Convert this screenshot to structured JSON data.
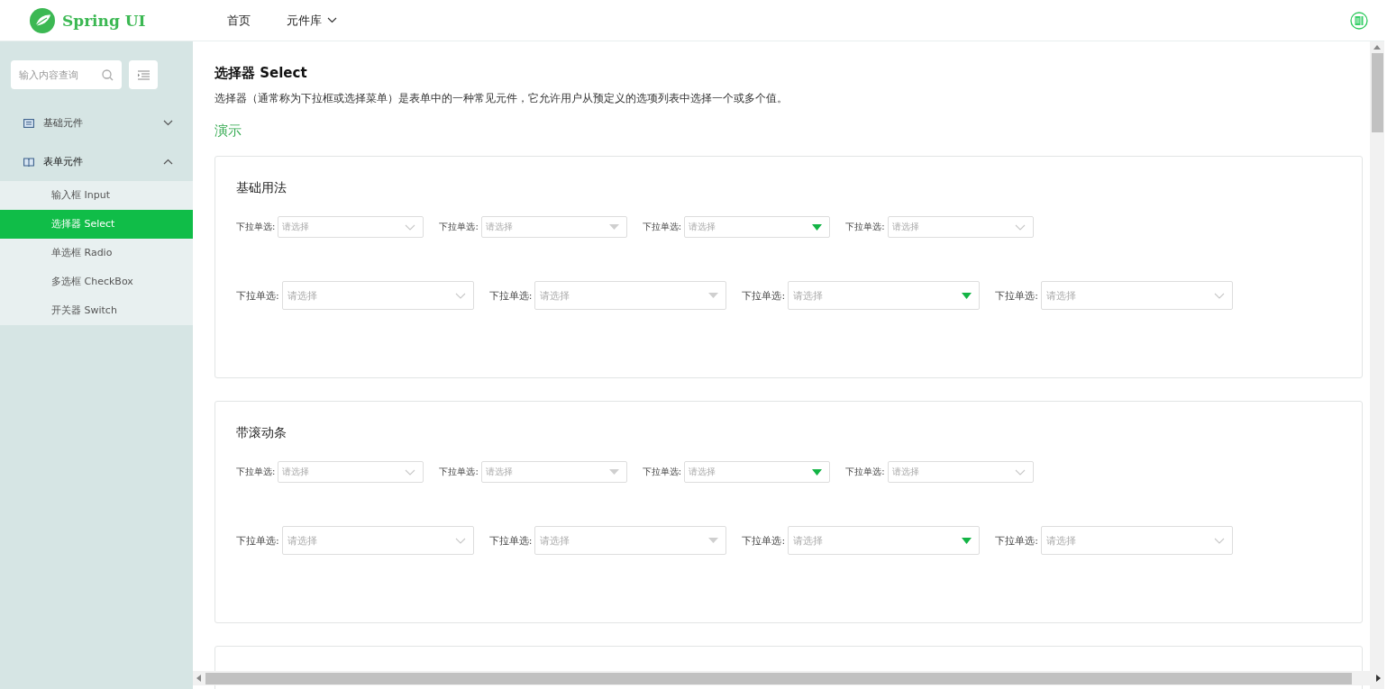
{
  "header": {
    "logo": "Spring UI",
    "nav": [
      {
        "label": "首页",
        "dropdown": false
      },
      {
        "label": "元件库",
        "dropdown": true
      }
    ]
  },
  "sidebar": {
    "search": {
      "placeholder": "输入内容查询"
    },
    "groups": [
      {
        "label": "基础元件",
        "expanded": false
      },
      {
        "label": "表单元件",
        "expanded": true,
        "children": [
          {
            "label": "输入框 Input",
            "selected": false
          },
          {
            "label": "选择器 Select",
            "selected": true
          },
          {
            "label": "单选框 Radio",
            "selected": false
          },
          {
            "label": "多选框 CheckBox",
            "selected": false
          },
          {
            "label": "开关器 Switch",
            "selected": false
          }
        ]
      }
    ]
  },
  "page": {
    "title": "选择器 Select",
    "description": "选择器（通常称为下拉框或选择菜单）是表单中的一种常见元件，它允许用户从预定义的选项列表中选择一个或多个值。",
    "demo_heading": "演示",
    "sections": [
      {
        "title": "基础用法",
        "rows": [
          {
            "kind": "small",
            "selects": [
              {
                "label": "下拉单选:",
                "placeholder": "请选择",
                "kind": "chevron"
              },
              {
                "label": "下拉单选:",
                "placeholder": "请选择",
                "kind": "caret"
              },
              {
                "label": "下拉单选:",
                "placeholder": "请选择",
                "kind": "caret-active"
              },
              {
                "label": "下拉单选:",
                "placeholder": "请选择",
                "kind": "chevron"
              }
            ]
          },
          {
            "kind": "large",
            "selects": [
              {
                "label": "下拉单选:",
                "placeholder": "请选择",
                "kind": "chevron"
              },
              {
                "label": "下拉单选:",
                "placeholder": "请选择",
                "kind": "caret"
              },
              {
                "label": "下拉单选:",
                "placeholder": "请选择",
                "kind": "caret-active"
              },
              {
                "label": "下拉单选:",
                "placeholder": "请选择",
                "kind": "chevron"
              }
            ]
          }
        ]
      },
      {
        "title": "带滚动条",
        "rows": [
          {
            "kind": "small",
            "selects": [
              {
                "label": "下拉单选:",
                "placeholder": "请选择",
                "kind": "chevron"
              },
              {
                "label": "下拉单选:",
                "placeholder": "请选择",
                "kind": "caret"
              },
              {
                "label": "下拉单选:",
                "placeholder": "请选择",
                "kind": "caret-active"
              },
              {
                "label": "下拉单选:",
                "placeholder": "请选择",
                "kind": "chevron"
              }
            ]
          },
          {
            "kind": "large",
            "selects": [
              {
                "label": "下拉单选:",
                "placeholder": "请选择",
                "kind": "chevron"
              },
              {
                "label": "下拉单选:",
                "placeholder": "请选择",
                "kind": "caret"
              },
              {
                "label": "下拉单选:",
                "placeholder": "请选择",
                "kind": "caret-active"
              },
              {
                "label": "下拉单选:",
                "placeholder": "请选择",
                "kind": "chevron"
              }
            ]
          }
        ]
      }
    ]
  }
}
